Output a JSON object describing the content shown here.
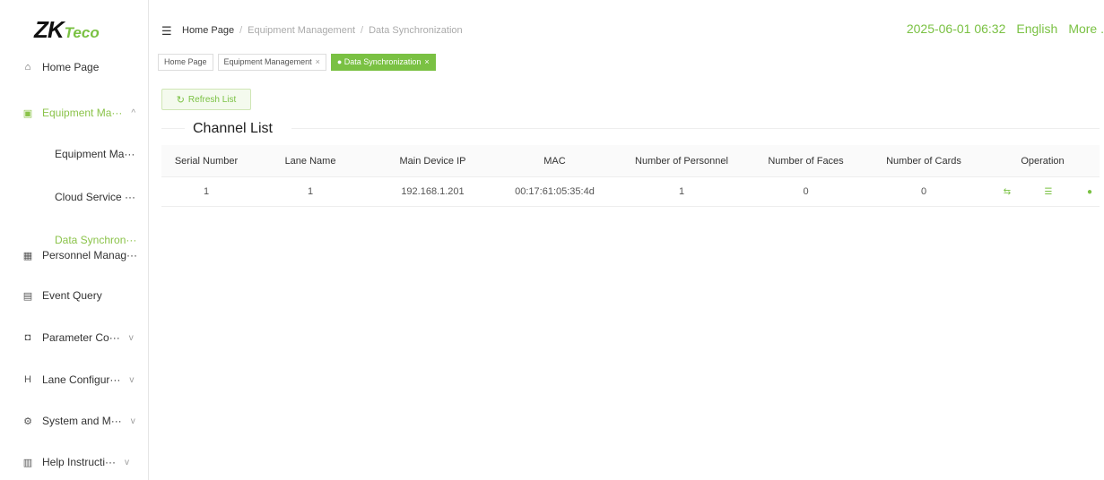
{
  "brand": {
    "logo_main": "ZK",
    "logo_accent": "Teco"
  },
  "sidebar": {
    "items": [
      {
        "icon": "home-icon",
        "label": "Home Page"
      },
      {
        "icon": "device-icon",
        "label": "Equipment Ma···",
        "arrow": "^"
      },
      {
        "icon": "personnel-icon",
        "label": "Personnel Manag···"
      },
      {
        "icon": "event-icon",
        "label": "Event Query"
      },
      {
        "icon": "parameter-icon",
        "label": "Parameter Co···",
        "arrow": "v"
      },
      {
        "icon": "lane-icon",
        "label": "Lane Configur···",
        "arrow": "v"
      },
      {
        "icon": "system-icon",
        "label": "System and M···",
        "arrow": "v"
      },
      {
        "icon": "help-icon",
        "label": "Help Instructi···",
        "arrow": "v"
      }
    ],
    "sub_items": [
      {
        "label": "Equipment Ma···"
      },
      {
        "label": "Cloud Service ···"
      },
      {
        "label": "Data Synchron···"
      }
    ]
  },
  "header": {
    "breadcrumb": [
      "Home Page",
      "Equipment Management",
      "Data Synchronization"
    ],
    "datetime": "2025-06-01 06:32",
    "language": "English",
    "more": "More ."
  },
  "tabs": [
    {
      "label": "Home Page"
    },
    {
      "label": "Equipment Management",
      "close": "×"
    },
    {
      "label": "● Data Synchronization",
      "close": "×"
    }
  ],
  "toolbar": {
    "refresh_label": "Refresh List"
  },
  "section": {
    "title": "Channel List"
  },
  "table": {
    "columns": [
      "Serial Number",
      "Lane Name",
      "Main Device IP",
      "MAC",
      "Number of Personnel",
      "Number of Faces",
      "Number of Cards",
      "Operation"
    ],
    "rows": [
      [
        "1",
        "1",
        "192.168.1.201",
        "00:17:61:05:35:4d",
        "1",
        "0",
        "0"
      ]
    ],
    "operations": [
      "sync-icon",
      "list-icon",
      "status-dot-icon"
    ]
  },
  "colors": {
    "accent": "#7ac143"
  }
}
